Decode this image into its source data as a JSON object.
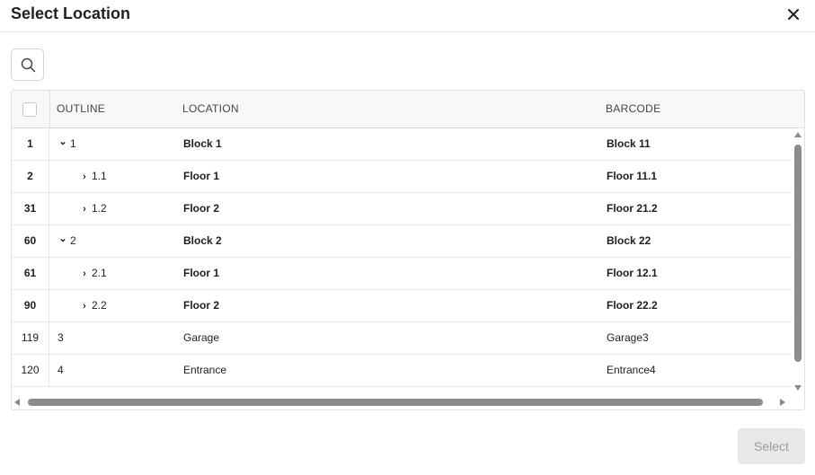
{
  "dialog": {
    "title": "Select Location",
    "close_icon": "close-icon"
  },
  "toolbar": {
    "search_icon": "search-icon"
  },
  "grid": {
    "columns": {
      "outline": "OUTLINE",
      "location": "LOCATION",
      "barcode": "BARCODE"
    },
    "rows": [
      {
        "index": "1",
        "twist": "⌄",
        "outline": "1",
        "location": "Block 1",
        "barcode": "Block 11",
        "bold": true,
        "indent": 0
      },
      {
        "index": "2",
        "twist": "›",
        "outline": "1.1",
        "location": "Floor 1",
        "barcode": "Floor 11.1",
        "bold": true,
        "indent": 1
      },
      {
        "index": "31",
        "twist": "›",
        "outline": "1.2",
        "location": "Floor 2",
        "barcode": "Floor 21.2",
        "bold": true,
        "indent": 1
      },
      {
        "index": "60",
        "twist": "⌄",
        "outline": "2",
        "location": "Block 2",
        "barcode": "Block 22",
        "bold": true,
        "indent": 0
      },
      {
        "index": "61",
        "twist": "›",
        "outline": "2.1",
        "location": "Floor 1",
        "barcode": "Floor 12.1",
        "bold": true,
        "indent": 1
      },
      {
        "index": "90",
        "twist": "›",
        "outline": "2.2",
        "location": "Floor 2",
        "barcode": "Floor 22.2",
        "bold": true,
        "indent": 1
      },
      {
        "index": "119",
        "twist": "",
        "outline": "3",
        "location": "Garage",
        "barcode": "Garage3",
        "bold": false,
        "indent": 0
      },
      {
        "index": "120",
        "twist": "",
        "outline": "4",
        "location": "Entrance",
        "barcode": "Entrance4",
        "bold": false,
        "indent": 0
      }
    ]
  },
  "footer": {
    "select_label": "Select"
  }
}
